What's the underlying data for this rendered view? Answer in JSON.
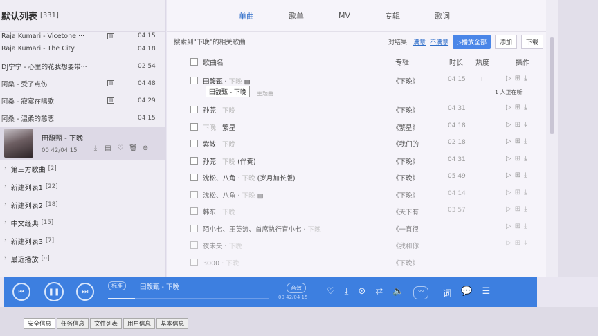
{
  "sidebar": {
    "list_title": "默认列表",
    "list_count": "[331]",
    "tracks": [
      {
        "name": "Raja Kumari - Vicetone ···",
        "duration": "04 15",
        "has_mv": true
      },
      {
        "name": "Raja Kumari - The City",
        "duration": "04 18",
        "has_mv": false
      },
      {
        "name": "DJ宁宁 - 心里的花我想要带···",
        "duration": "02 54",
        "has_mv": false
      },
      {
        "name": "阿桑 - 受了点伤",
        "duration": "04 48",
        "has_mv": true
      },
      {
        "name": "阿桑 - 寂寞在唱歌",
        "duration": "04 29",
        "has_mv": true
      },
      {
        "name": "阿桑 - 温柔的慈悲",
        "duration": "04 15",
        "has_mv": false
      }
    ],
    "now_playing": {
      "title": "田馥甄 - 下晚",
      "time": "00 42/04 15"
    },
    "groups": [
      {
        "name": "第三方歌曲",
        "count": "[2]"
      },
      {
        "name": "新建列表1",
        "count": "[22]"
      },
      {
        "name": "新建列表2",
        "count": "[18]"
      },
      {
        "name": "中文经典",
        "count": "[15]"
      },
      {
        "name": "新建列表3",
        "count": "[7]"
      },
      {
        "name": "最近播放",
        "count": "[··]"
      }
    ]
  },
  "tabs": [
    "单曲",
    "歌单",
    "MV",
    "专辑",
    "歌词"
  ],
  "toolbar": {
    "search_result": "搜索到\"下晚\"的相关歌曲",
    "filter_label": "对结果:",
    "satisfied": "满意",
    "unsatisfied": "不满意",
    "play_all": "▷播放全部",
    "add": "添加",
    "download": "下载"
  },
  "columns": {
    "name": "歌曲名",
    "album": "专辑",
    "duration": "时长",
    "popularity": "热度",
    "actions": "操作"
  },
  "songs": [
    {
      "title": "田馥甄",
      "artist": "下晚",
      "extra": "",
      "album": "《下晚》",
      "duration": "04 15",
      "mv": true
    },
    {
      "title": "孙莞",
      "artist": "下晚",
      "extra": "",
      "album": "《下晚》",
      "duration": "04 31",
      "mv": false
    },
    {
      "title": "下晚",
      "artist": "繁星",
      "extra": "",
      "album": "《繁星》",
      "duration": "04 18",
      "mv": false
    },
    {
      "title": "紫敏",
      "artist": "下晚",
      "extra": "",
      "album": "《我们的",
      "duration": "02 18",
      "mv": false
    },
    {
      "title": "孙莞",
      "artist": "下晚",
      "extra": "(伴奏)",
      "album": "《下晚》",
      "duration": "04 31",
      "mv": false
    },
    {
      "title": "沈松、八角",
      "artist": "下晚",
      "extra": "(岁月加长版)",
      "album": "《下晚》",
      "duration": "05 49",
      "mv": false
    },
    {
      "title": "沈松、八角",
      "artist": "下晚",
      "extra": "",
      "album": "《下晚》",
      "duration": "04 14",
      "mv": true
    },
    {
      "title": "韩东",
      "artist": "下晚",
      "extra": "",
      "album": "《天下有",
      "duration": "03 57",
      "mv": false
    },
    {
      "title": "陌小七、王英涛、首席执行官小七",
      "artist": "下晚",
      "extra": "",
      "album": "《一直很",
      "duration": "",
      "mv": false
    },
    {
      "title": "夜未央",
      "artist": "下晚",
      "extra": "",
      "album": "《我和你",
      "duration": "",
      "mv": false
    },
    {
      "title": "3000",
      "artist": "下晚",
      "extra": "",
      "album": "《下晚》",
      "duration": "",
      "mv": false
    }
  ],
  "tooltip": "田馥甄 - 下晚",
  "theme_song": "主题曲",
  "fan_tag": "1 人正在听",
  "player": {
    "quality": "标准",
    "title": "田馥甄 - 下晚",
    "effect": "音效",
    "time": "00 42/04 15",
    "progress": 0.17,
    "lyric_pill": "词"
  },
  "status_tabs": [
    "安全信息",
    "任务信息",
    "文件列表",
    "用户信息",
    "基本信息"
  ],
  "colors": {
    "accent": "#3d7fe0",
    "link": "#2f6ec9"
  }
}
